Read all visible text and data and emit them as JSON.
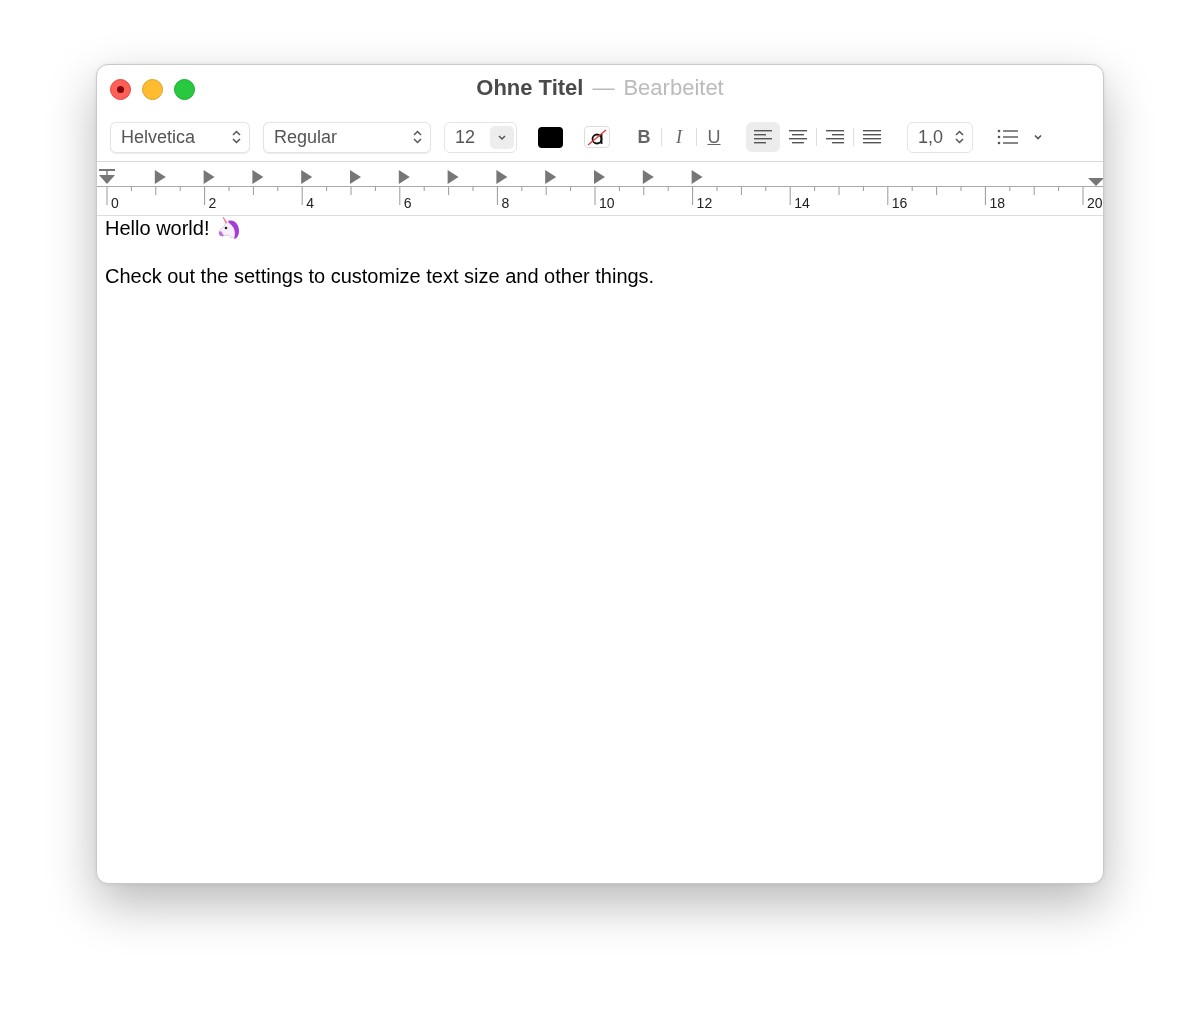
{
  "window": {
    "title": "Ohne Titel",
    "separator": "—",
    "status": "Bearbeitet"
  },
  "toolbar": {
    "font_family": "Helvetica",
    "font_style": "Regular",
    "font_size": "12",
    "styles": [
      {
        "kind": "bold",
        "label": "B",
        "on": false
      },
      {
        "kind": "italic",
        "label": "I",
        "on": false
      },
      {
        "kind": "underline",
        "label": "U",
        "on": false
      }
    ],
    "alignments": [
      {
        "kind": "left",
        "selected": true
      },
      {
        "kind": "center",
        "selected": false
      },
      {
        "kind": "right",
        "selected": false
      },
      {
        "kind": "justify",
        "selected": false
      }
    ],
    "line_spacing": "1,0"
  },
  "ruler": {
    "labels": [
      "0",
      "2",
      "4",
      "6",
      "8",
      "10",
      "12",
      "14",
      "16",
      "18",
      "20"
    ]
  },
  "document": {
    "paragraphs": [
      {
        "kind": "with_unicorn",
        "text": "Hello world!"
      },
      {
        "kind": "plain",
        "text": "Check out the settings to customize text size and other things."
      }
    ]
  }
}
